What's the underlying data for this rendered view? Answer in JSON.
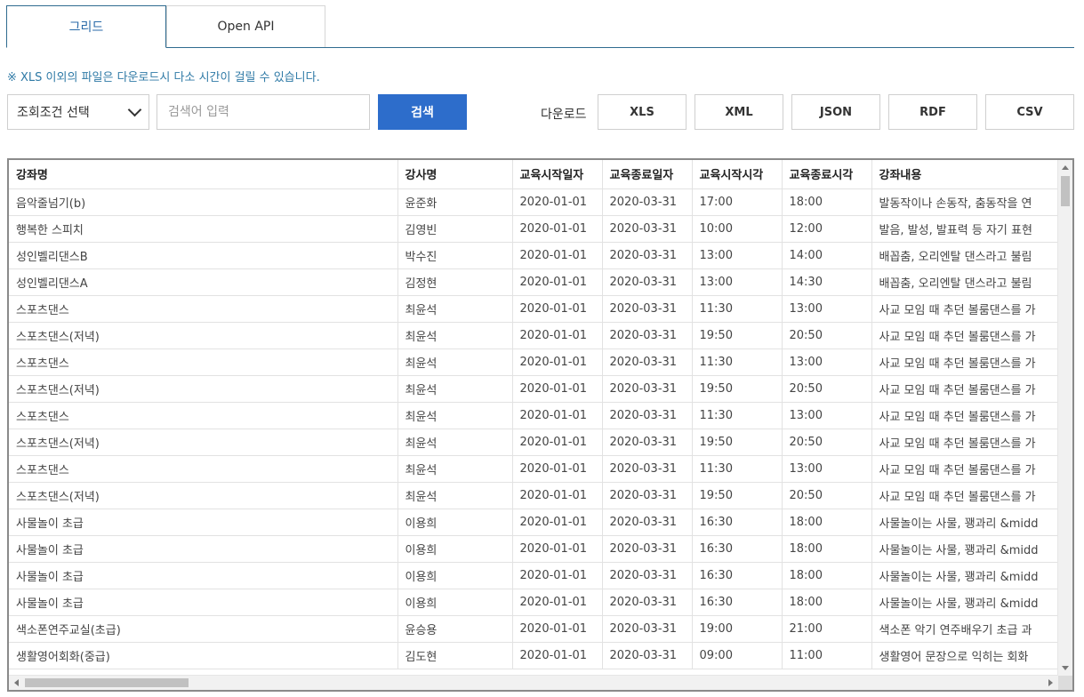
{
  "tabs": [
    {
      "label": "그리드"
    },
    {
      "label": "Open API"
    }
  ],
  "notice": "※ XLS 이외의 파일은 다운로드시 다소 시간이 걸릴 수 있습니다.",
  "search": {
    "select_value": "조회조건 선택",
    "placeholder": "검색어 입력",
    "button_label": "검색"
  },
  "download": {
    "label": "다운로드",
    "buttons": [
      "XLS",
      "XML",
      "JSON",
      "RDF",
      "CSV"
    ]
  },
  "grid": {
    "columns": [
      "강좌명",
      "강사명",
      "교육시작일자",
      "교육종료일자",
      "교육시작시각",
      "교육종료시각",
      "강좌내용"
    ],
    "rows": [
      [
        "음악줄넘기(b)",
        "윤준화",
        "2020-01-01",
        "2020-03-31",
        "17:00",
        "18:00",
        "발동작이나 손동작, 춤동작을 연"
      ],
      [
        "행복한 스피치",
        "김영빈",
        "2020-01-01",
        "2020-03-31",
        "10:00",
        "12:00",
        "발음, 발성, 발표력 등 자기 표현"
      ],
      [
        "성인벨리댄스B",
        "박수진",
        "2020-01-01",
        "2020-03-31",
        "13:00",
        "14:00",
        "배꼽춤, 오리엔탈 댄스라고 불림"
      ],
      [
        "성인벨리댄스A",
        "김정현",
        "2020-01-01",
        "2020-03-31",
        "13:00",
        "14:30",
        "배꼽춤, 오리엔탈 댄스라고 불림"
      ],
      [
        "스포츠댄스",
        "최윤석",
        "2020-01-01",
        "2020-03-31",
        "11:30",
        "13:00",
        "사교 모임 때 추던 볼룸댄스를 가"
      ],
      [
        "스포츠댄스(저녁)",
        "최윤석",
        "2020-01-01",
        "2020-03-31",
        "19:50",
        "20:50",
        "사교 모임 때 추던 볼룸댄스를 가"
      ],
      [
        "스포츠댄스",
        "최윤석",
        "2020-01-01",
        "2020-03-31",
        "11:30",
        "13:00",
        "사교 모임 때 추던 볼룸댄스를 가"
      ],
      [
        "스포츠댄스(저녁)",
        "최윤석",
        "2020-01-01",
        "2020-03-31",
        "19:50",
        "20:50",
        "사교 모임 때 추던 볼룸댄스를 가"
      ],
      [
        "스포츠댄스",
        "최윤석",
        "2020-01-01",
        "2020-03-31",
        "11:30",
        "13:00",
        "사교 모임 때 추던 볼룸댄스를 가"
      ],
      [
        "스포츠댄스(저녁)",
        "최윤석",
        "2020-01-01",
        "2020-03-31",
        "19:50",
        "20:50",
        "사교 모임 때 추던 볼룸댄스를 가"
      ],
      [
        "스포츠댄스",
        "최윤석",
        "2020-01-01",
        "2020-03-31",
        "11:30",
        "13:00",
        "사교 모임 때 추던 볼룸댄스를 가"
      ],
      [
        "스포츠댄스(저녁)",
        "최윤석",
        "2020-01-01",
        "2020-03-31",
        "19:50",
        "20:50",
        "사교 모임 때 추던 볼룸댄스를 가"
      ],
      [
        "사물놀이 초급",
        "이용희",
        "2020-01-01",
        "2020-03-31",
        "16:30",
        "18:00",
        "사물놀이는 사물, 꽹과리 &midd"
      ],
      [
        "사물놀이 초급",
        "이용희",
        "2020-01-01",
        "2020-03-31",
        "16:30",
        "18:00",
        "사물놀이는 사물, 꽹과리 &midd"
      ],
      [
        "사물놀이 초급",
        "이용희",
        "2020-01-01",
        "2020-03-31",
        "16:30",
        "18:00",
        "사물놀이는 사물, 꽹과리 &midd"
      ],
      [
        "사물놀이 초급",
        "이용희",
        "2020-01-01",
        "2020-03-31",
        "16:30",
        "18:00",
        "사물놀이는 사물, 꽹과리 &midd"
      ],
      [
        "색소폰연주교실(초급)",
        "윤승용",
        "2020-01-01",
        "2020-03-31",
        "19:00",
        "21:00",
        "색소폰 악기 연주배우기 초급 과"
      ],
      [
        "생활영어회화(중급)",
        "김도현",
        "2020-01-01",
        "2020-03-31",
        "09:00",
        "11:00",
        "생활영어 문장으로 익히는 회화"
      ]
    ]
  }
}
